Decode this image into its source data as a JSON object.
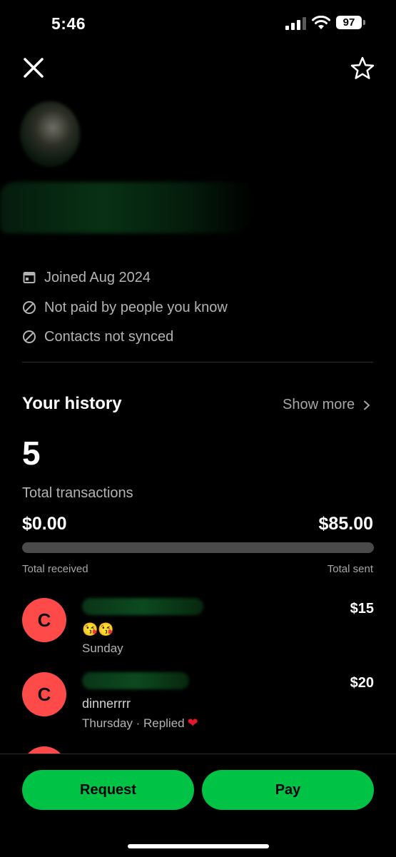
{
  "status": {
    "time": "5:46",
    "battery": "97"
  },
  "profile": {
    "info": [
      {
        "icon": "calendar-icon",
        "text": "Joined Aug 2024"
      },
      {
        "icon": "prohibited-icon",
        "text": "Not paid by people you know"
      },
      {
        "icon": "prohibited-icon",
        "text": "Contacts not synced"
      }
    ]
  },
  "history": {
    "title": "Your history",
    "show_more": "Show more",
    "total_count": "5",
    "total_label": "Total transactions",
    "received_amount": "$0.00",
    "sent_amount": "$85.00",
    "received_label": "Total received",
    "sent_label": "Total sent",
    "received_fraction": 0
  },
  "transactions": [
    {
      "initial": "C",
      "amount": "$15",
      "note": "😘😘",
      "meta": "Sunday"
    },
    {
      "initial": "C",
      "amount": "$20",
      "note": "dinnerrrr",
      "meta": "Thursday · Replied"
    }
  ],
  "actions": {
    "request_label": "Request",
    "pay_label": "Pay"
  },
  "colors": {
    "accent": "#00c244",
    "avatar": "#ff4a4a",
    "background": "#000000"
  }
}
